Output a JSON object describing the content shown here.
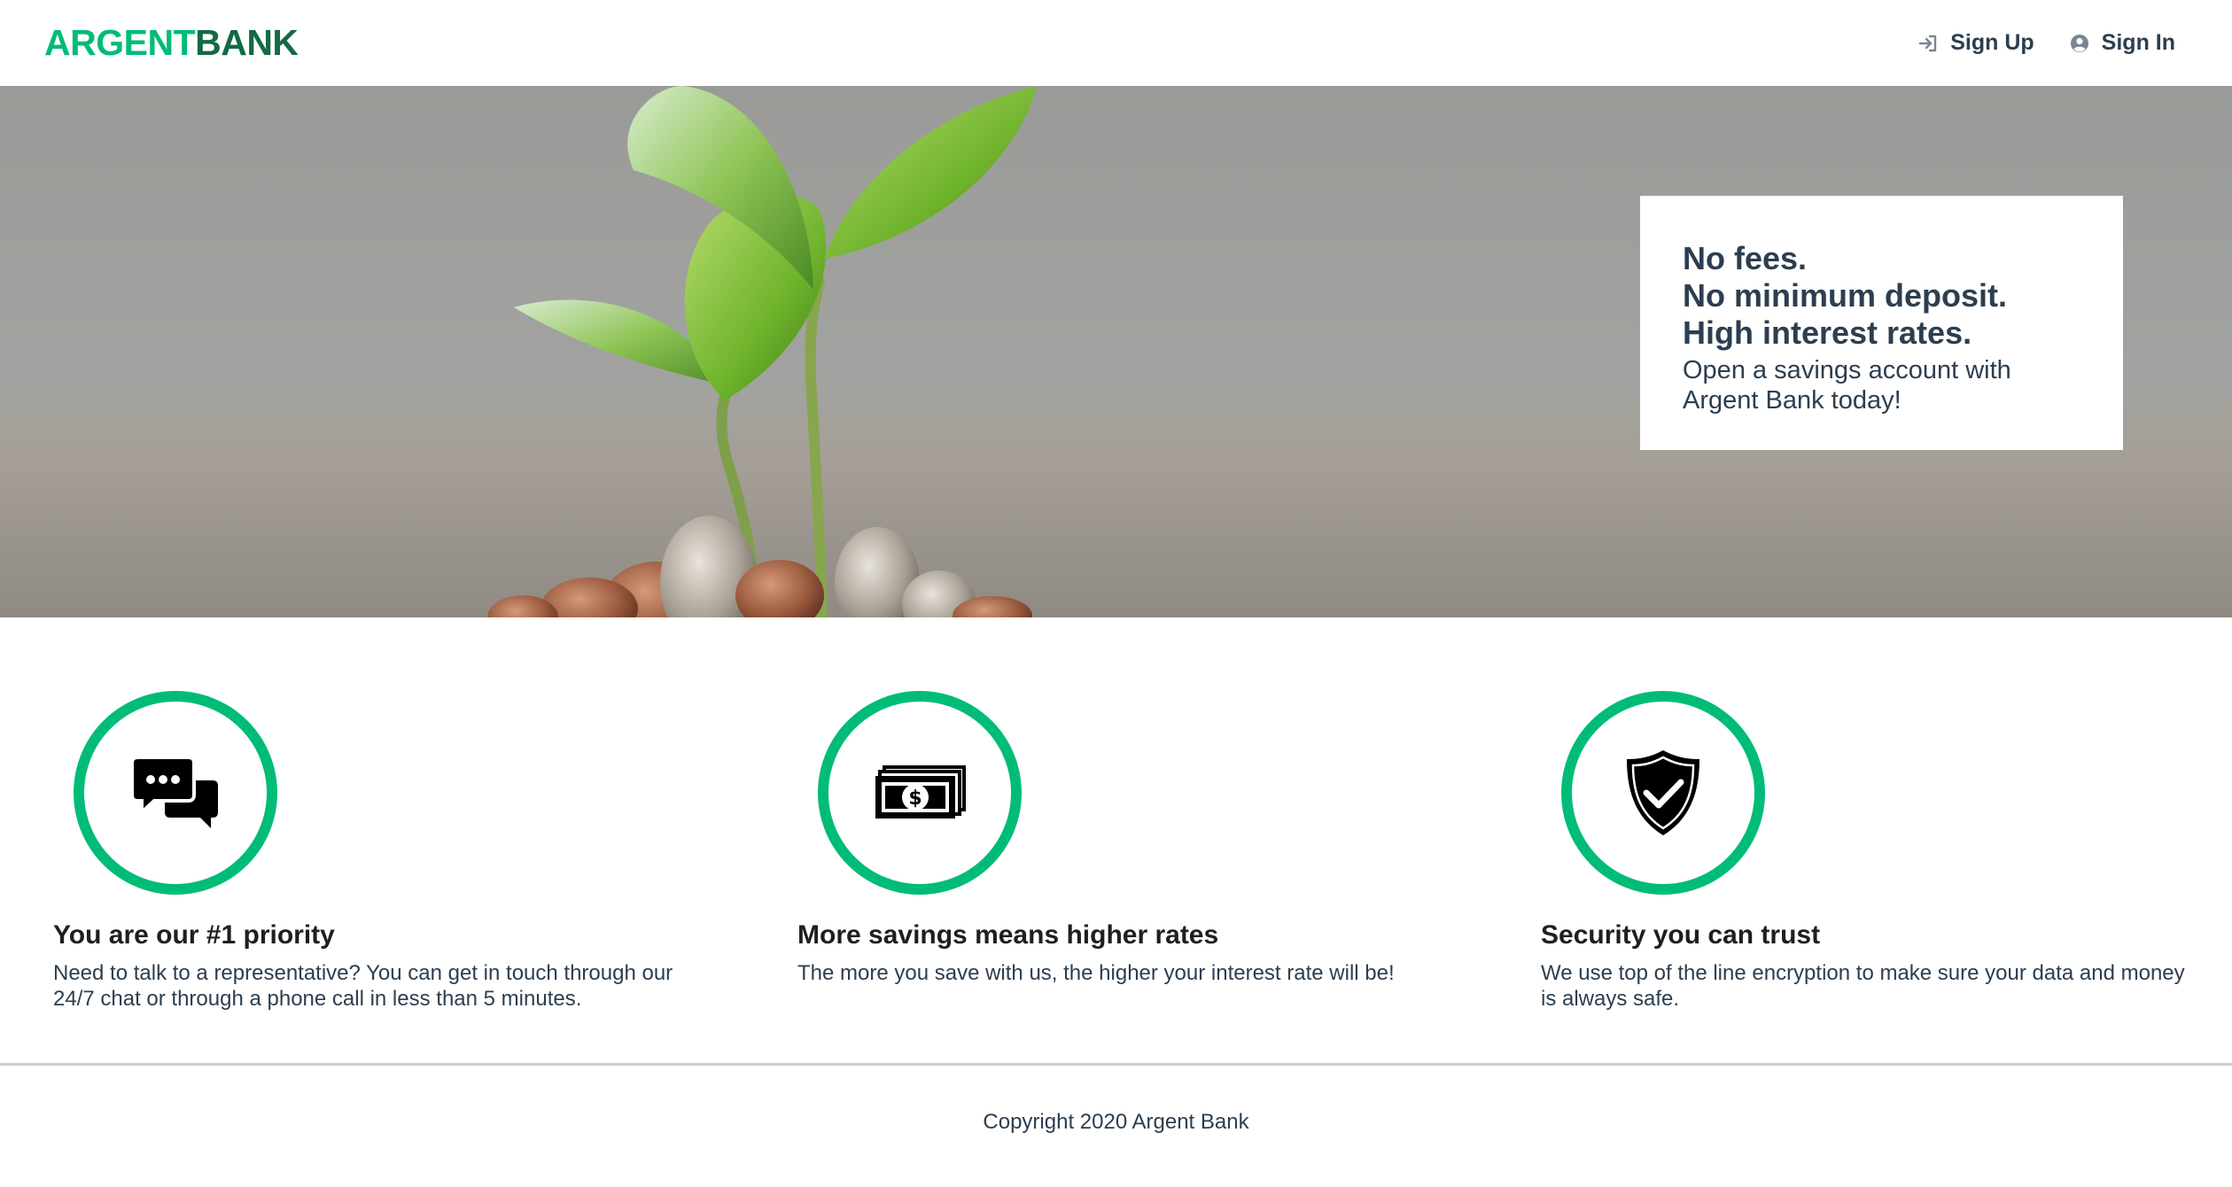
{
  "header": {
    "logo_part1": "ARGENT",
    "logo_part2": "BANK",
    "nav": {
      "sign_up": "Sign Up",
      "sign_in": "Sign In"
    }
  },
  "hero": {
    "subtitles": [
      "No fees.",
      "No minimum deposit.",
      "High interest rates."
    ],
    "text": "Open a savings account with Argent Bank today!"
  },
  "features": [
    {
      "icon": "chat-bubbles-icon",
      "title": "You are our #1 priority",
      "text": "Need to talk to a representative? You can get in touch through our 24/7 chat or through a phone call in less than 5 minutes."
    },
    {
      "icon": "money-bills-icon",
      "title": "More savings means higher rates",
      "text": "The more you save with us, the higher your interest rate will be!"
    },
    {
      "icon": "shield-check-icon",
      "title": "Security you can trust",
      "text": "We use top of the line encryption to make sure your data and money is always safe."
    }
  ],
  "footer": {
    "copyright": "Copyright 2020 Argent Bank"
  },
  "colors": {
    "accent": "#00bc77",
    "logo_dark": "#136a43",
    "text": "#2c3e50"
  }
}
